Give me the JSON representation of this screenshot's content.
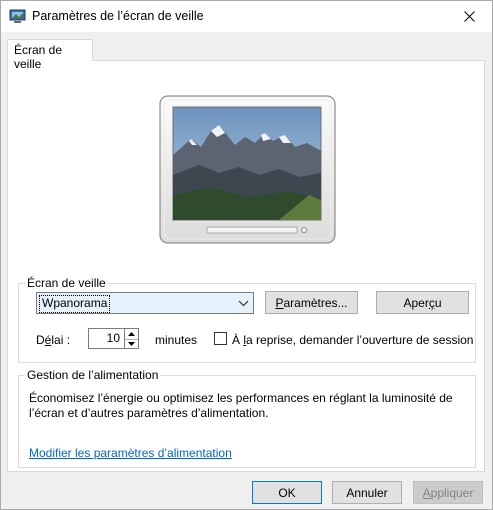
{
  "window": {
    "title": "Paramètres de l’écran de veille",
    "close_glyph": "✕"
  },
  "tab": {
    "label": "Écran de veille"
  },
  "screensaver_group": {
    "legend": "Écran de veille",
    "selected": "Wpanorama",
    "settings_button": {
      "pre": "",
      "u": "P",
      "post": "aramètres..."
    },
    "preview_button": {
      "pre": "Aper",
      "u": "ç",
      "post": "u"
    },
    "delay_label": {
      "pre": "D",
      "u": "é",
      "post": "lai :"
    },
    "delay_value": "10",
    "minutes_label": "minutes",
    "resume_label": {
      "pre": "À ",
      "u": "l",
      "post": "a reprise, demander l’ouverture de session"
    },
    "resume_checked": false
  },
  "power_group": {
    "legend": "Gestion de l’alimentation",
    "description": "Économisez l’énergie ou optimisez les performances en réglant la luminosité de l’écran et d’autres paramètres d’alimentation.",
    "link": "Modifier les paramètres d’alimentation"
  },
  "footer": {
    "ok": "OK",
    "cancel": "Annuler",
    "apply": {
      "pre": "",
      "u": "A",
      "post": "ppliquer"
    }
  },
  "colors": {
    "accent": "#0078d7",
    "link": "#0066cc"
  },
  "icons": [
    "screensaver-app-icon",
    "close-icon",
    "chevron-down-icon",
    "spin-up-icon",
    "spin-down-icon"
  ]
}
